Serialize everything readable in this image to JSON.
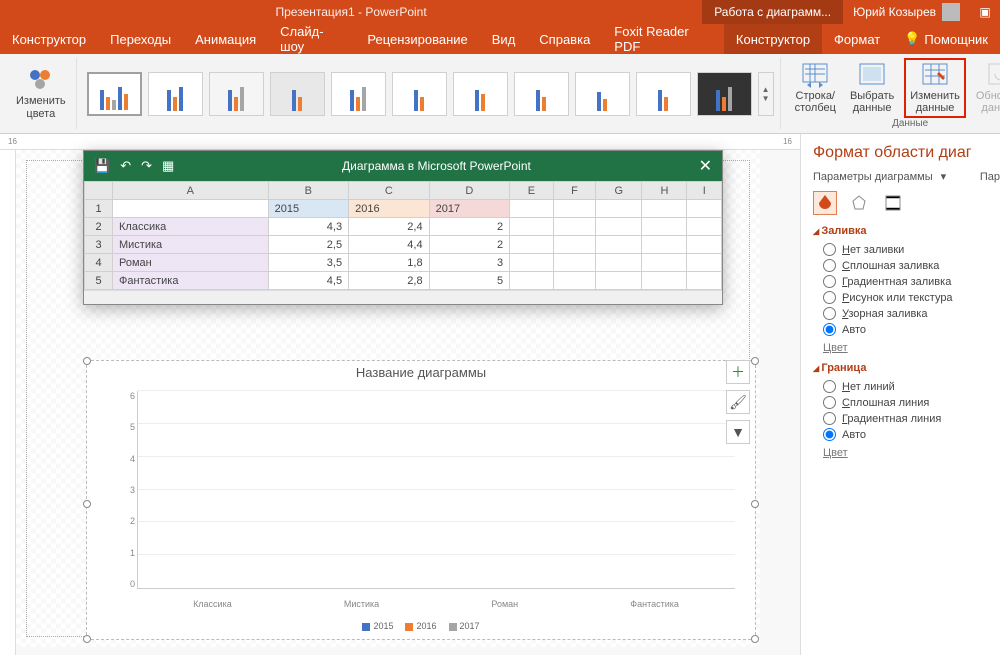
{
  "titlebar": {
    "doc_title": "Презентация1 - PowerPoint",
    "context_tab": "Работа с диаграмм...",
    "user_name": "Юрий Козырев"
  },
  "tabs": [
    "Конструктор",
    "Переходы",
    "Анимация",
    "Слайд-шоу",
    "Рецензирование",
    "Вид",
    "Справка",
    "Foxit Reader PDF"
  ],
  "tool_tabs": {
    "design": "Конструктор",
    "format": "Формат"
  },
  "help_hint": "Помощник",
  "ribbon": {
    "change_colors": "Изменить\nцвета",
    "data_group_label": "Данные",
    "switch_rc": "Строка/\nстолбец",
    "select_data": "Выбрать\nданные",
    "edit_data": "Изменить\nданные",
    "refresh_data": "Обновить\nданные"
  },
  "ruler": {
    "left": "16",
    "right": "16"
  },
  "data_editor": {
    "title": "Диаграмма в Microsoft PowerPoint",
    "columns": [
      "",
      "A",
      "B",
      "C",
      "D",
      "E",
      "F",
      "G",
      "H",
      "I"
    ],
    "rows": [
      {
        "n": "1",
        "cells": [
          "",
          "2015",
          "2016",
          "2017",
          "",
          "",
          "",
          "",
          ""
        ]
      },
      {
        "n": "2",
        "cells": [
          "Классика",
          "4,3",
          "2,4",
          "2",
          "",
          "",
          "",
          "",
          ""
        ]
      },
      {
        "n": "3",
        "cells": [
          "Мистика",
          "2,5",
          "4,4",
          "2",
          "",
          "",
          "",
          "",
          ""
        ]
      },
      {
        "n": "4",
        "cells": [
          "Роман",
          "3,5",
          "1,8",
          "3",
          "",
          "",
          "",
          "",
          ""
        ]
      },
      {
        "n": "5",
        "cells": [
          "Фантастика",
          "4,5",
          "2,8",
          "5",
          "",
          "",
          "",
          "",
          ""
        ]
      }
    ]
  },
  "chart_data": {
    "type": "bar",
    "title": "Название диаграммы",
    "categories": [
      "Классика",
      "Мистика",
      "Роман",
      "Фантастика"
    ],
    "series": [
      {
        "name": "2015",
        "values": [
          4.3,
          2.5,
          3.5,
          4.5
        ],
        "color": "#4472c4"
      },
      {
        "name": "2016",
        "values": [
          2.4,
          4.4,
          1.8,
          2.8
        ],
        "color": "#ed7d31"
      },
      {
        "name": "2017",
        "values": [
          2.0,
          2.0,
          3.0,
          5.0
        ],
        "color": "#a5a5a5"
      }
    ],
    "ylim": [
      0,
      6
    ],
    "yticks": [
      0,
      1,
      2,
      3,
      4,
      5,
      6
    ]
  },
  "format_pane": {
    "title": "Формат области диаг",
    "sub": "Параметры диаграммы",
    "sub2": "Пар",
    "fill_section": "Заливка",
    "fill_options": [
      "Нет заливки",
      "Сплошная заливка",
      "Градиентная заливка",
      "Рисунок или текстура",
      "Узорная заливка",
      "Авто"
    ],
    "fill_selected": 5,
    "color_label": "Цвет",
    "border_section": "Граница",
    "border_options": [
      "Нет линий",
      "Сплошная линия",
      "Градиентная линия",
      "Авто"
    ],
    "border_selected": 3
  }
}
